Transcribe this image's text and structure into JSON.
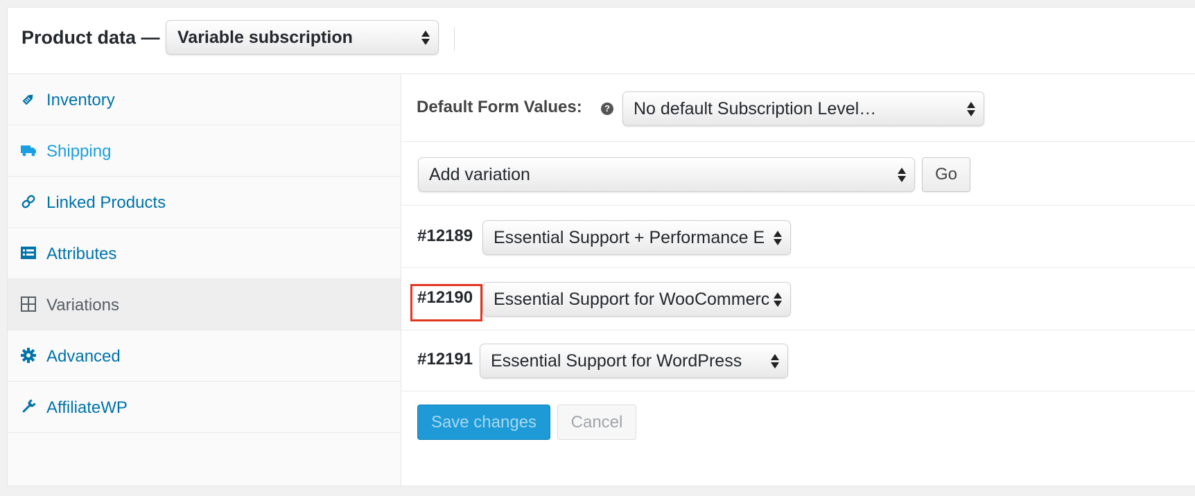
{
  "header": {
    "title": "Product data —",
    "product_type": "Variable subscription"
  },
  "sidebar": {
    "items": [
      {
        "label": "Inventory",
        "icon": "tag-icon"
      },
      {
        "label": "Shipping",
        "icon": "truck-icon"
      },
      {
        "label": "Linked Products",
        "icon": "link-icon"
      },
      {
        "label": "Attributes",
        "icon": "list-icon"
      },
      {
        "label": "Variations",
        "icon": "grid-icon",
        "active": true
      },
      {
        "label": "Advanced",
        "icon": "gear-icon"
      },
      {
        "label": "AffiliateWP",
        "icon": "wrench-icon"
      }
    ]
  },
  "main": {
    "default_form_label": "Default Form Values:",
    "help_symbol": "?",
    "default_form_value": "No default Subscription Level…",
    "add_variation_value": "Add variation",
    "go_label": "Go",
    "variations": [
      {
        "id": "#12189",
        "value": "Essential Support + Performance E"
      },
      {
        "id": "#12190",
        "value": "Essential Support for WooCommerce",
        "highlighted": true
      },
      {
        "id": "#12191",
        "value": "Essential Support for WordPress"
      }
    ],
    "save_label": "Save changes",
    "cancel_label": "Cancel"
  },
  "colors": {
    "link": "#0073aa",
    "primary_button": "#1e9bd7",
    "highlight_border": "#e2361f"
  }
}
